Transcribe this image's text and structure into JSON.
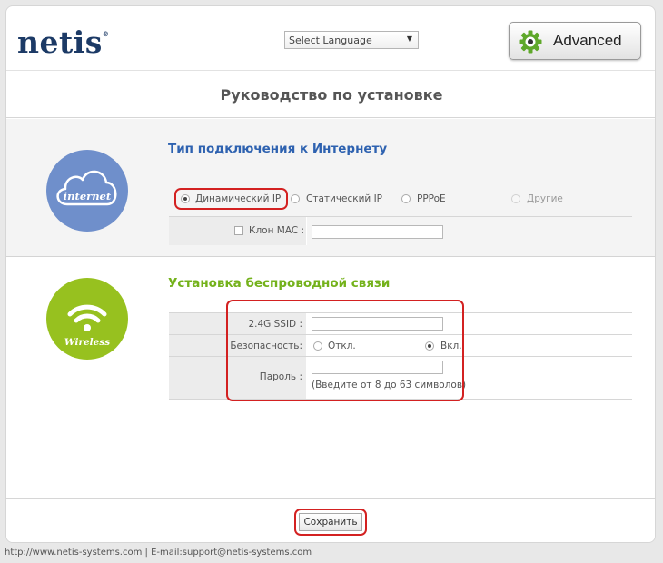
{
  "brand": {
    "logo_text": "netis"
  },
  "header": {
    "language_select": {
      "value": "Select Language"
    },
    "advanced_button": {
      "label": "Advanced"
    }
  },
  "page_title": "Руководство по установке",
  "internet": {
    "icon_label": "internet",
    "title": "Тип подключения к Интернету",
    "options": [
      {
        "label": "Динамический IP",
        "selected": true
      },
      {
        "label": "Статический IP",
        "selected": false
      },
      {
        "label": "PPPoE",
        "selected": false
      },
      {
        "label": "Другие",
        "selected": false,
        "disabled": true
      }
    ],
    "clone_mac": {
      "label": "Клон MAC :",
      "checked": false,
      "value": ""
    }
  },
  "wireless": {
    "icon_label": "Wireless",
    "title": "Установка беспроводной связи",
    "ssid": {
      "label": "2.4G SSID :",
      "value": ""
    },
    "security": {
      "label": "Безопасность:",
      "options": [
        {
          "label": "Откл.",
          "selected": false
        },
        {
          "label": "Вкл.",
          "selected": true
        }
      ]
    },
    "password": {
      "label": "Пароль :",
      "value": "",
      "hint": "(Введите от 8 до 63 символов)"
    }
  },
  "save_button": {
    "label": "Сохранить"
  },
  "footer": {
    "text": "http://www.netis-systems.com | E-mail:support@netis-systems.com"
  },
  "colors": {
    "logo": "#1c3a66",
    "internet_accent": "#2e62b0",
    "internet_circle": "#6f8fcb",
    "wireless_accent": "#74b21b",
    "wireless_circle": "#97c11f",
    "highlight": "#d32121"
  }
}
